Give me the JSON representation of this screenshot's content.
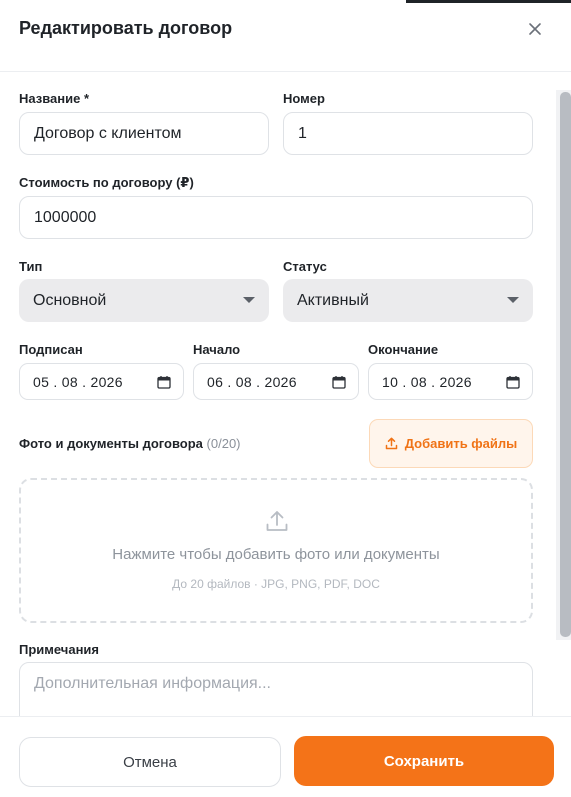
{
  "header": {
    "title": "Редактировать договор"
  },
  "form": {
    "name": {
      "label": "Название *",
      "value": "Договор с клиентом"
    },
    "number": {
      "label": "Номер",
      "value": "1"
    },
    "cost": {
      "label": "Стоимость по договору (₽)",
      "value": "1000000"
    },
    "type": {
      "label": "Тип",
      "value": "Основной"
    },
    "status": {
      "label": "Статус",
      "value": "Активный"
    },
    "signed": {
      "label": "Подписан",
      "value": "05 . 08 . 2026"
    },
    "start": {
      "label": "Начало",
      "value": "06 . 08 . 2026"
    },
    "end": {
      "label": "Окончание",
      "value": "10 . 08 . 2026"
    },
    "files": {
      "label": "Фото и документы договора",
      "count": "(0/20)",
      "add_label": "Добавить файлы",
      "dropzone_title": "Нажмите чтобы добавить фото или документы",
      "dropzone_hint": "До 20 файлов · JPG, PNG, PDF, DOC"
    },
    "notes": {
      "label": "Примечания",
      "placeholder": "Дополнительная информация..."
    }
  },
  "footer": {
    "cancel_label": "Отмена",
    "save_label": "Сохранить"
  },
  "colors": {
    "accent": "#f47318",
    "accent_soft": "#fff5ec",
    "select_bg": "#ebebed"
  },
  "icons": [
    "close-icon",
    "calendar-icon",
    "upload-icon"
  ]
}
